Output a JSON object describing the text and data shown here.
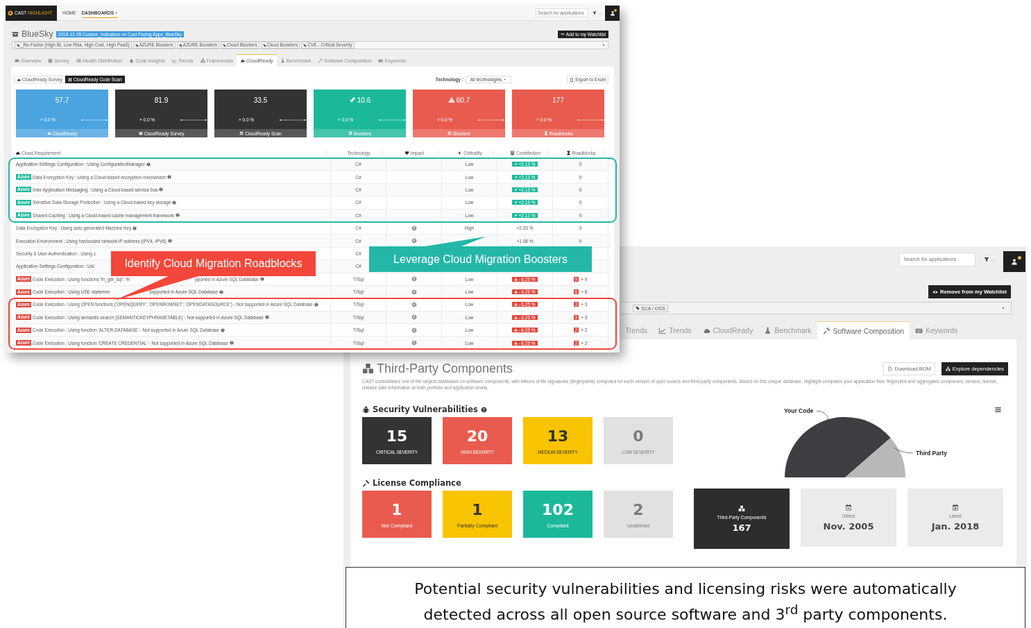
{
  "cloudready_window": {
    "brand": {
      "primary": "CAST",
      "accent": "HIGHLIGHT"
    },
    "nav": [
      {
        "label": "HOME",
        "selected": false
      },
      {
        "label": "DASHBOARDS",
        "selected": true
      }
    ],
    "search": {
      "placeholder": "Search for applications"
    },
    "filter_more": "...",
    "notification": true,
    "title": "BlueSky",
    "campaign": "2018-12-05 Custom_Indicators on Cust Facing Apps_BlueSky",
    "watchlist_button": "Add to my Watchlist",
    "tags": [
      "_Re-Factor (High BI, Low Risk, High Cost, High PaaS)",
      "AZURE Blockers",
      "AZURE Boosters",
      "Cloud Blockers",
      "Cloud Boosters",
      "CVE - Critical Severity"
    ],
    "tabs": [
      {
        "label": "Overview",
        "selected": false
      },
      {
        "label": "Survey",
        "selected": false
      },
      {
        "label": "Health Distribution",
        "selected": false
      },
      {
        "label": "Code Insights",
        "selected": false
      },
      {
        "label": "Trends",
        "selected": false
      },
      {
        "label": "Frameworks",
        "selected": false
      },
      {
        "label": "CloudReady",
        "selected": true
      },
      {
        "label": "Benchmark",
        "selected": false
      },
      {
        "label": "Software Composition",
        "selected": false
      },
      {
        "label": "Keywords",
        "selected": false
      }
    ],
    "views": [
      {
        "label": "CloudReady Survey",
        "selected": false
      },
      {
        "label": "CloudReady Code Scan",
        "selected": true
      }
    ],
    "technology_label": "Technology :",
    "technology_value": "All technologies",
    "export_button": "Export to Excel",
    "kpis": [
      {
        "kind": "cloudready",
        "value": "57.7",
        "change": "+ 0.0 %",
        "label": "CloudReady",
        "color": "#4ba3e0"
      },
      {
        "kind": "survey",
        "value": "81.9",
        "change": "+ 0.0 %",
        "label": "CloudReady Survey",
        "color": "#333333"
      },
      {
        "kind": "scan",
        "value": "33.5",
        "change": "+ 0.0 %",
        "label": "CloudReady Scan",
        "color": "#333333"
      },
      {
        "kind": "boosters",
        "value": "10.6",
        "change": "+ 0.0 %",
        "label": "Boosters",
        "color": "#1bb99a"
      },
      {
        "kind": "blockers",
        "value": "60.7",
        "change": "+ 0.0 %",
        "label": "Blockers",
        "color": "#e95b4f"
      },
      {
        "kind": "roadblocks",
        "value": "177",
        "change": "+ 0.0 %",
        "label": "Roadblocks",
        "color": "#e95b4f"
      }
    ],
    "table": {
      "columns": [
        "Cloud Requirement",
        "Technology",
        "Impact",
        "Criticality",
        "Contribution",
        "Roadblocks"
      ],
      "rows": [
        {
          "tag": null,
          "requirement": "Application Settings Configuration : Using ConfigurationManager",
          "help": true,
          "technology": "C#",
          "impact": false,
          "criticality": "Low",
          "contribution": {
            "kind": "booster",
            "text": "+2.13 %"
          },
          "roadblocks": {
            "text": "0"
          }
        },
        {
          "tag": "Azure",
          "requirement": "Data Encryption Key : Using a Cloud-based encryption mechanism",
          "help": true,
          "technology": "C#",
          "impact": false,
          "criticality": "Low",
          "contribution": {
            "kind": "booster",
            "text": "+2.13 %"
          },
          "roadblocks": {
            "text": "0"
          }
        },
        {
          "tag": "Azure",
          "requirement": "Inter Application Messaging : Using a Cloud-based service bus",
          "help": true,
          "technology": "C#",
          "impact": false,
          "criticality": "Low",
          "contribution": {
            "kind": "booster",
            "text": "+2.13 %"
          },
          "roadblocks": {
            "text": "0"
          }
        },
        {
          "tag": "Azure",
          "requirement": "Sensitive Data Storage Protection : Using a Cloud-based key storage",
          "help": true,
          "technology": "C#",
          "impact": false,
          "criticality": "Low",
          "contribution": {
            "kind": "booster",
            "text": "+2.13 %"
          },
          "roadblocks": {
            "text": "0"
          }
        },
        {
          "tag": "Azure",
          "requirement": "Shared Caching : Using a Cloud-based cache management framework",
          "help": true,
          "technology": "C#",
          "impact": false,
          "criticality": "Low",
          "contribution": {
            "kind": "booster",
            "text": "+2.13 %"
          },
          "roadblocks": {
            "text": "0"
          }
        },
        {
          "tag": null,
          "requirement": "Data Encryption Key : Using auto generated Machine Key",
          "help": true,
          "technology": "C#",
          "impact": true,
          "criticality": "High",
          "contribution": {
            "kind": "plain",
            "text": "+2.03 %"
          },
          "roadblocks": {
            "text": "0"
          }
        },
        {
          "tag": null,
          "requirement": "Execution Environment : Using hardcoded network IP address (IPV4, IPV6)",
          "help": true,
          "technology": "C#",
          "impact": true,
          "contribution": {
            "kind": "plain",
            "text": "+1.08 %"
          },
          "roadblocks": {
            "text": "0"
          }
        },
        {
          "tag": null,
          "requirement": "Security & User Authentication : Using c",
          "technology": "C#"
        },
        {
          "tag": null,
          "requirement": "Application Settings Configuration : Usi",
          "technology": "C#"
        },
        {
          "tag": "Azure",
          "requirement": "Code Execution : Using functions 'fn_get_sql', 'fn",
          "requirement_tail": "pported in Azure SQL Database",
          "help": true,
          "technology": "T/Sql",
          "impact": true,
          "criticality": "Low",
          "contribution": {
            "kind": "blocker",
            "text": "- 6.25 %"
          },
          "roadblocks": {
            "count": "9",
            "text": "+ 9"
          }
        },
        {
          "tag": "Azure",
          "requirement": "Code Execution : Using USE statemen",
          "requirement_tail": "supported in Azure SQL Database",
          "help": true,
          "technology": "T/Sql",
          "impact": true,
          "criticality": "Low",
          "contribution": {
            "kind": "blocker",
            "text": "- 6.25 %"
          },
          "roadblocks": {
            "count": "6",
            "text": "+ 6"
          }
        },
        {
          "tag": "Azure",
          "requirement": "Code Execution : Using OPEN functions ('OPENQUERY', 'OPENROWSET', 'OPENDATASOURCE') - Not supported in Azure SQL Database",
          "help": true,
          "technology": "T/Sql",
          "impact": true,
          "criticality": "Low",
          "contribution": {
            "kind": "blocker",
            "text": "- 6.25 %"
          },
          "roadblocks": {
            "count": "3",
            "text": "+ 3"
          }
        },
        {
          "tag": "Azure",
          "requirement": "Code Execution : Using semantic search (SEMANTICKEYPHRASETABLE) - Not supported in Azure SQL Database",
          "help": true,
          "technology": "T/Sql",
          "impact": true,
          "criticality": "Low",
          "contribution": {
            "kind": "blocker",
            "text": "- 6.25 %"
          },
          "roadblocks": {
            "count": "3",
            "text": "+ 3"
          }
        },
        {
          "tag": "Azure",
          "requirement": "Code Execution : Using function 'ALTER DATABASE' - Not supported in Azure SQL Database",
          "help": true,
          "technology": "T/Sql",
          "impact": true,
          "criticality": "Low",
          "contribution": {
            "kind": "blocker",
            "text": "- 6.25 %"
          },
          "roadblocks": {
            "count": "2",
            "text": "+ 2"
          }
        },
        {
          "tag": "Azure",
          "requirement": "Code Execution : Using function 'CREATE CREDENTIAL' - Not supported in Azure SQL Database",
          "help": true,
          "technology": "T/Sql",
          "impact": true,
          "criticality": "Low",
          "contribution": {
            "kind": "blocker",
            "text": "- 6.25 %"
          },
          "roadblocks": {
            "count": "2",
            "text": "+ 2"
          }
        }
      ]
    }
  },
  "components_window": {
    "search": {
      "placeholder": "Search for applications"
    },
    "filter_more": "...",
    "notification": true,
    "watchlist_button": "Remove from my Watchlist",
    "tags": [
      "SCA / OSS"
    ],
    "tabs": [
      {
        "label": "Trends",
        "selected": false
      },
      {
        "label": "Trends",
        "selected": false
      },
      {
        "label": "CloudReady",
        "selected": false
      },
      {
        "label": "Benchmark",
        "selected": false
      },
      {
        "label": "Software Composition",
        "selected": true
      },
      {
        "label": "Keywords",
        "selected": false
      }
    ],
    "heading": "Third-Party Components",
    "bom_button": "Download BOM",
    "explore_button": "Explore dependencies",
    "description": "CAST consolidates one of the largest databases on software components, with billions of file signatures (fingerprints) computed for each version of open source and third-party components. Based on this unique database, Highlight compares your application files' fingerprint and aggregates component, version, license, release date information at both portfolio and application levels.",
    "vulnerabilities": {
      "title": "Security Vulnerabilities",
      "tiles": [
        {
          "value": "15",
          "label": "CRITICAL SEVERITY",
          "color": "#333333"
        },
        {
          "value": "20",
          "label": "HIGH SEVERITY",
          "color": "#e95b4f"
        },
        {
          "value": "13",
          "label": "MEDIUM SEVERITY",
          "color": "#f8c400"
        },
        {
          "value": "0",
          "label": "LOW SEVERITY",
          "color": "#e1e1e1"
        }
      ]
    },
    "licenses": {
      "title": "License Compliance",
      "tiles": [
        {
          "value": "1",
          "label": "Not Compliant",
          "color": "#e95b4f"
        },
        {
          "value": "1",
          "label": "Partially Compliant",
          "color": "#f8c400"
        },
        {
          "value": "102",
          "label": "Compliant",
          "color": "#1bb99a"
        },
        {
          "value": "2",
          "label": "Undefined",
          "color": "#e1e1e1"
        }
      ]
    },
    "code_origin": {
      "your_code_label": "Your Code",
      "third_party_label": "Third Party"
    },
    "stats": [
      {
        "kind": "components",
        "label": "Third-Party Components",
        "value": "167"
      },
      {
        "kind": "oldest",
        "label": "Oldest",
        "value": "Nov. 2005"
      },
      {
        "kind": "latest",
        "label": "Latest",
        "value": "Jan. 2018"
      }
    ]
  },
  "callouts": [
    {
      "text": "Identify Cloud Migration Roadblocks",
      "color": "#f2473a"
    },
    {
      "text": "Leverage Cloud Migration Boosters",
      "color": "#24b7a8"
    }
  ],
  "caption": "Potential security vulnerabilities and licensing risks were automatically detected across all open source software and 3$^{rd}$ party components."
}
